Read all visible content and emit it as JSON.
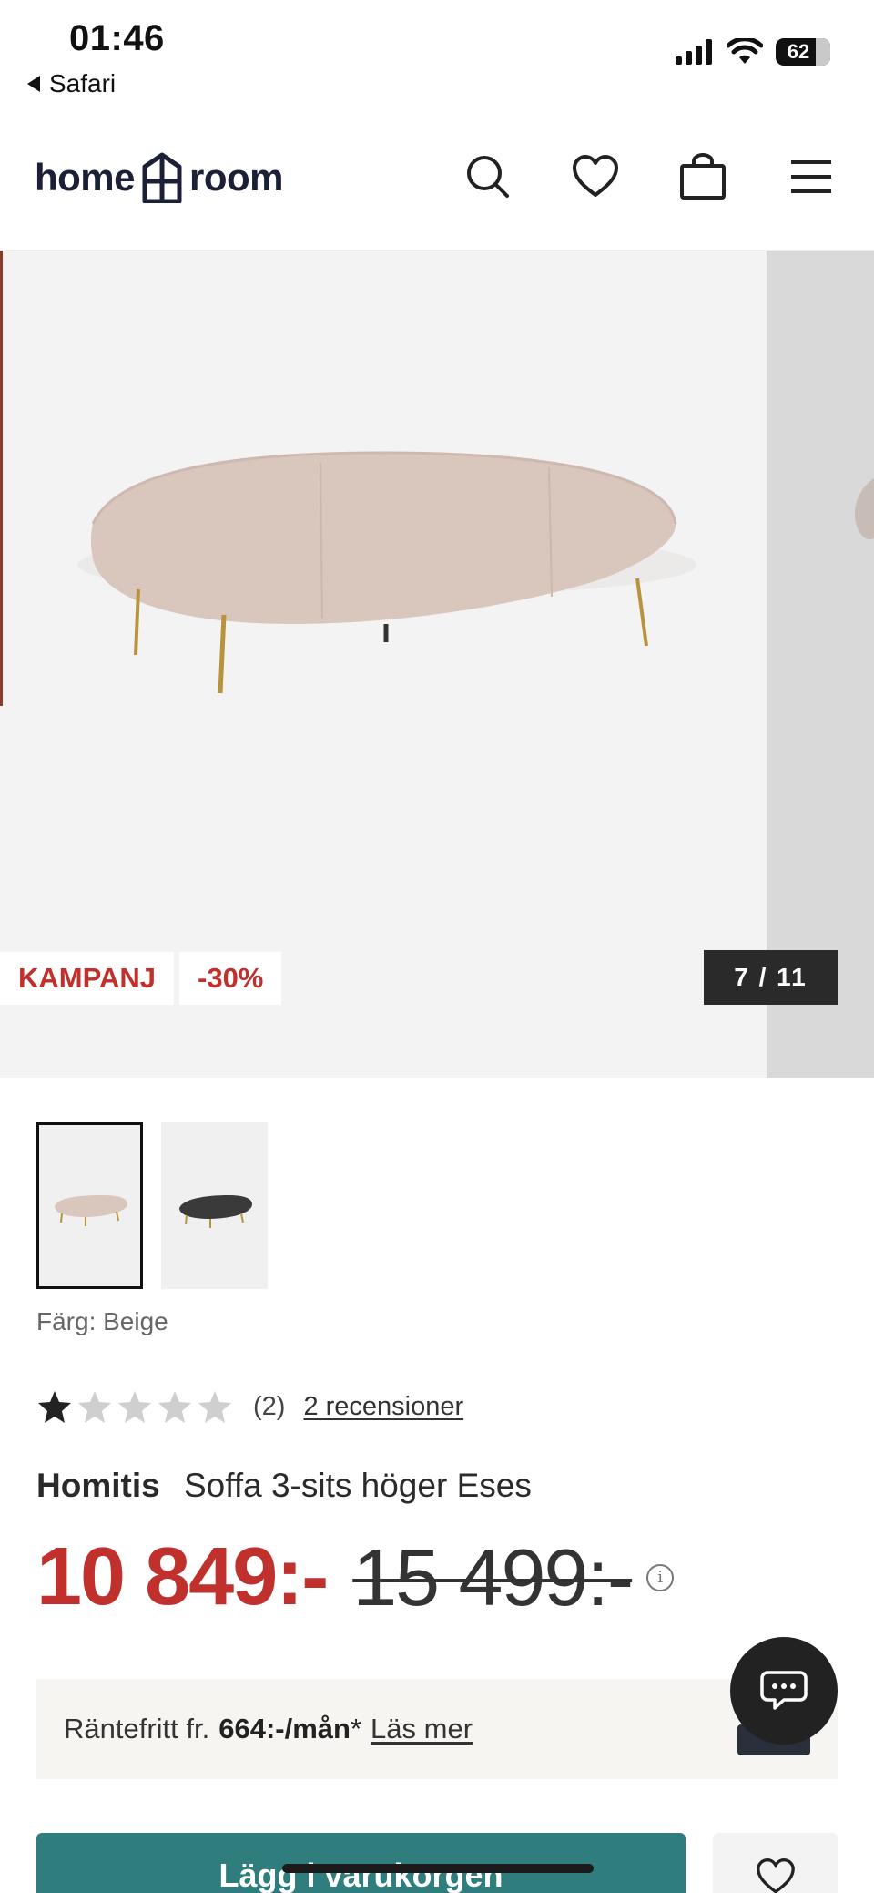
{
  "status_bar": {
    "time": "01:46",
    "back_app": "Safari",
    "battery": "62"
  },
  "header": {
    "logo_left": "home",
    "logo_right": "room",
    "icons": [
      "search-icon",
      "heart-icon",
      "bag-icon",
      "menu-icon"
    ]
  },
  "gallery": {
    "badges": [
      "KAMPANJ",
      "-30%"
    ],
    "counter": "7 / 11"
  },
  "thumbnails": [
    {
      "name": "beige-sofa-thumbnail",
      "color": "#d9c7be",
      "selected": true
    },
    {
      "name": "black-sofa-thumbnail",
      "color": "#3b3a3a",
      "selected": false
    }
  ],
  "product": {
    "color_label": "Färg: Beige",
    "rating": 1,
    "rating_max": 5,
    "rating_count": "(2)",
    "reviews_link": "2 recensioner",
    "brand": "Homitis",
    "name": "Soffa 3-sits höger Eses",
    "price": "10 849:-",
    "old_price": "15 499:-"
  },
  "finance": {
    "prefix": "Räntefritt fr.",
    "amount": "664:-/mån",
    "asterisk": "*",
    "link": "Läs mer"
  },
  "actions": {
    "add_to_cart": "Lägg i varukorgen"
  },
  "colors": {
    "accent_red": "#c0312d",
    "button_teal": "#2f7d7c",
    "sofa_beige": "#d9c7be"
  }
}
